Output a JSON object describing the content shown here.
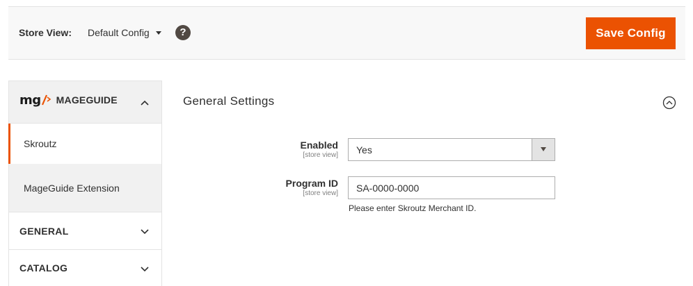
{
  "topbar": {
    "store_view_label": "Store View:",
    "store_view_value": "Default Config",
    "help_icon": "?",
    "save_label": "Save Config",
    "save_color": "#eb5202"
  },
  "sidebar": {
    "brand": {
      "logo_text": "mg",
      "logo_icon": "mageguide-slash-logo",
      "name": "MAGEGUIDE",
      "accent": "#eb5202"
    },
    "items": [
      {
        "label": "Skroutz",
        "active": true
      },
      {
        "label": "MageGuide Extension",
        "active": false
      }
    ],
    "sections": [
      {
        "label": "GENERAL"
      },
      {
        "label": "CATALOG"
      }
    ]
  },
  "main": {
    "section_title": "General Settings",
    "fields": {
      "enabled": {
        "label": "Enabled",
        "scope": "[store view]",
        "value": "Yes"
      },
      "program_id": {
        "label": "Program ID",
        "scope": "[store view]",
        "value": "SA-0000-0000",
        "note": "Please enter Skroutz Merchant ID."
      }
    }
  }
}
